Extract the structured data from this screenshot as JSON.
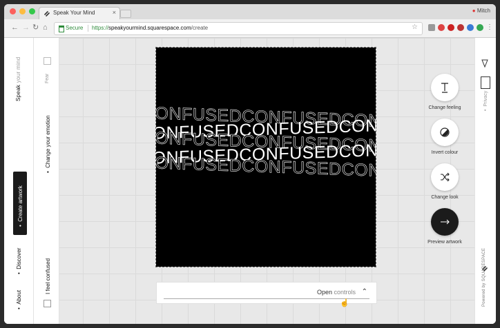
{
  "browser": {
    "tab_title": "Speak Your Mind",
    "tab_close": "×",
    "user": "Mitch",
    "secure_label": "Secure",
    "url_scheme": "https://",
    "url_host": "speakyourmind.squarespace.com",
    "url_path": "/create",
    "nav_back": "←",
    "nav_forward": "→",
    "nav_reload": "↻",
    "nav_home": "⌂",
    "star": "☆"
  },
  "sidebar": {
    "brand_bold": "Speak",
    "brand_light": "your mind",
    "create_label": "Create artwork",
    "discover_label": "Discover",
    "about_label": "About"
  },
  "emotion_panel": {
    "top_item": "Fear",
    "change_label": "Change your emotion",
    "current_label": "I feel confused"
  },
  "artwork": {
    "word": "CONFUSED",
    "rows": [
      "CONFUSEDCONFUSEDCONFUSED",
      "CONFUSEDCONFUSEDCONFUSED",
      "CONFUSEDCONFUSEDCONFUSED",
      "CONFUSEDCONFUSEDCONFUSED",
      "CONFUSEDCONFUSEDCONFUSED"
    ]
  },
  "controls": {
    "open_label": "Open",
    "controls_word": "controls",
    "chevron": "⌃"
  },
  "actions": [
    {
      "label": "Change feeling",
      "icon": "text-t-icon"
    },
    {
      "label": "Invert colour",
      "icon": "contrast-icon"
    },
    {
      "label": "Change look",
      "icon": "shuffle-icon"
    },
    {
      "label": "Preview artwork",
      "icon": "arrow-right-icon"
    }
  ],
  "right_rail": {
    "privacy_label": "Privacy",
    "powered_label": "Powered by SQUARESPACE"
  },
  "colors": {
    "accent_dark": "#1b1b1b",
    "secure_green": "#2e8b3b"
  }
}
